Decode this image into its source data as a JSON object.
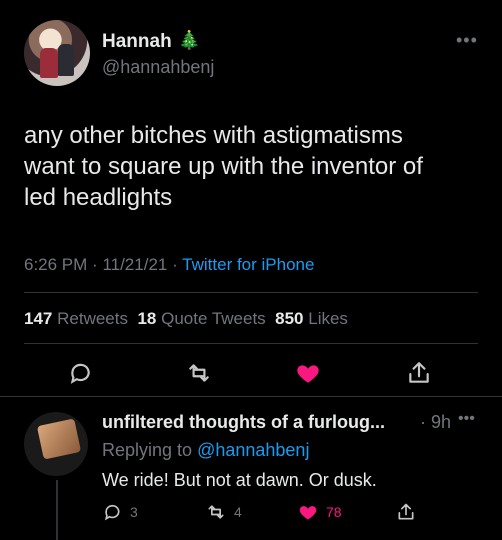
{
  "tweet": {
    "display_name": "Hannah",
    "name_emoji": "🎄",
    "handle": "@hannahbenj",
    "text_lines": [
      "any other bitches with astigmatisms",
      "want to square up with the inventor of",
      "led headlights"
    ],
    "time": "6:26 PM",
    "date": "11/21/21",
    "source": "Twitter for iPhone",
    "retweets_count": "147",
    "retweets_label": "Retweets",
    "quote_count": "18",
    "quote_label": "Quote Tweets",
    "likes_count": "850",
    "likes_label": "Likes"
  },
  "reply": {
    "display_name": "unfiltered thoughts of a furloug...",
    "time": "9h",
    "replying_prefix": "Replying to",
    "replying_handle": "@hannahbenj",
    "text": "We ride! But not at dawn. Or dusk.",
    "reply_count": "3",
    "retweet_count": "4",
    "like_count": "78"
  },
  "icons": {
    "more": "more-dots-icon",
    "reply": "reply-icon",
    "retweet": "retweet-icon",
    "like": "heart-icon",
    "share": "share-icon"
  },
  "colors": {
    "background": "#000000",
    "text": "#e7e9ea",
    "muted": "#71767b",
    "link": "#1d9bf0",
    "like": "#f91880",
    "divider": "#2f3336"
  }
}
